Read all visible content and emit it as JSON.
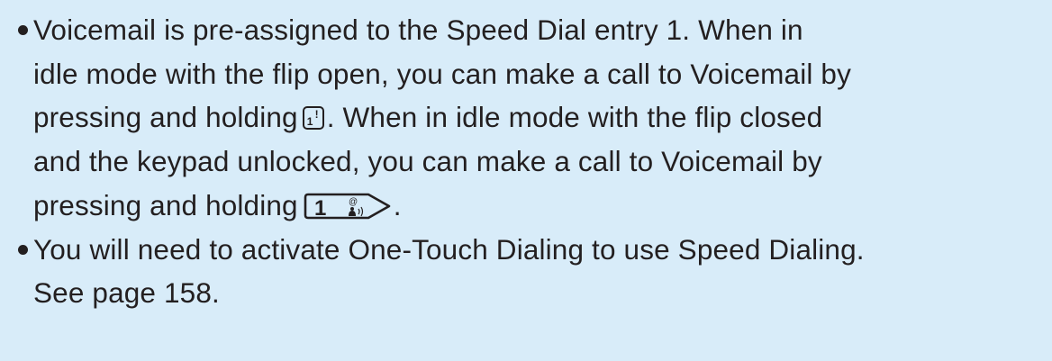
{
  "bullets": [
    {
      "lines": [
        "Voicemail is pre-assigned to the Speed Dial entry 1. When in",
        "idle mode with the flip open, you can make a call to Voicemail by"
      ],
      "line3_before": "pressing and holding",
      "key_small": {
        "number": "1",
        "mark": "!"
      },
      "line3_after": ". When in idle mode with the flip closed",
      "line4": "and the keypad unlocked, you can make a call to Voicemail by",
      "line5_before": "pressing and holding",
      "key_long": {
        "number": "1",
        "symbol": "@"
      },
      "line5_after": "."
    },
    {
      "lines": [
        "You will need to activate One-Touch Dialing to use Speed Dialing.",
        "See page 158."
      ]
    }
  ],
  "icons": {
    "key_small": "speed-dial-1-key-icon",
    "key_long": "side-1-key-icon"
  },
  "colors": {
    "background": "#d8ecf9",
    "text": "#231f20"
  }
}
